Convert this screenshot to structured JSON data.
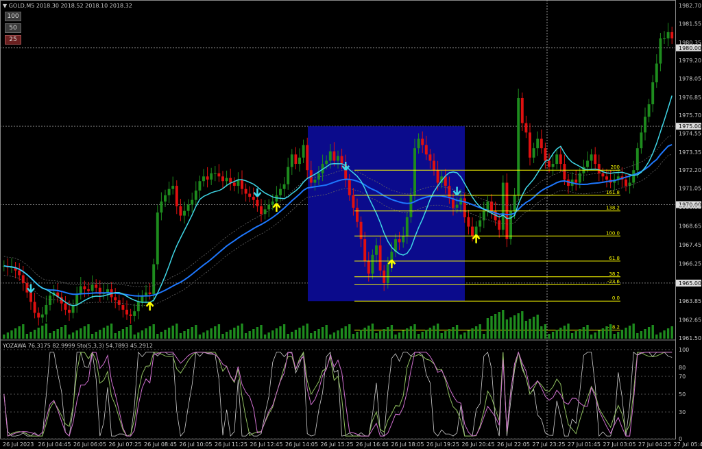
{
  "header": {
    "symbol": "GOLD,M5",
    "quote": "2018.30 2018.52 2018.10 2018.32"
  },
  "buttons": [
    {
      "label": "100",
      "color": "#3a3a3a"
    },
    {
      "label": "50",
      "color": "#3a3a3a"
    },
    {
      "label": "25",
      "color": "#6a2020"
    }
  ],
  "indicator": {
    "label": "YOZAWA 76.3175 82.9999",
    "sto_label": "Sto(5,3,3) 54.7893 45.2912"
  },
  "colors": {
    "bull": "#1e8c1e",
    "bear": "#e01010",
    "ma_fast": "#3fd6e6",
    "ma_slow": "#1e78ff",
    "fib": "#ffff00",
    "zone": "#0b0b8c",
    "osc_a": "#d070d0",
    "osc_b": "#90c060",
    "osc_c": "#cfcfcf"
  },
  "chart_data": {
    "type": "candlestick",
    "title": "GOLD,M5",
    "ylim": [
      1961.5,
      1982.7
    ],
    "price_axis_labels": [
      "1982.70",
      "1981.55",
      "1980.35",
      "1980.00",
      "1979.20",
      "1978.05",
      "1976.85",
      "1975.70",
      "1975.00",
      "1974.55",
      "1973.35",
      "1972.20",
      "1971.05",
      "1970.00",
      "1969.85",
      "1968.65",
      "1967.45",
      "1966.25",
      "1965.00",
      "1963.85",
      "1962.65",
      "1961.50"
    ],
    "highlighted_levels": [
      "1980.00",
      "1975.00",
      "1970.00",
      "1965.00"
    ],
    "time_labels": [
      "26 Jul 2023",
      "26 Jul 04:45",
      "26 Jul 06:05",
      "26 Jul 07:25",
      "26 Jul 08:45",
      "26 Jul 10:05",
      "26 Jul 11:25",
      "26 Jul 12:45",
      "26 Jul 14:05",
      "26 Jul 15:25",
      "26 Jul 16:45",
      "26 Jul 18:05",
      "26 Jul 19:25",
      "26 Jul 20:45",
      "26 Jul 22:05",
      "27 Jul 23:25",
      "27 Jul 01:45",
      "27 Jul 03:05",
      "27 Jul 04:25",
      "27 Jul 05:45"
    ],
    "fib_levels": [
      {
        "label": "200",
        "price": 1972.2
      },
      {
        "label": "161.8",
        "price": 1970.6
      },
      {
        "label": "138.2",
        "price": 1969.6
      },
      {
        "label": "100.0",
        "price": 1968.0
      },
      {
        "label": "61.8",
        "price": 1966.4
      },
      {
        "label": "38.2",
        "price": 1965.4
      },
      {
        "label": "-23.6",
        "price": 1964.9
      },
      {
        "label": "0.0",
        "price": 1963.85
      },
      {
        "label": "-38.2",
        "price": 1962.0
      }
    ],
    "zone": {
      "from_price": 1963.85,
      "to_price": 1975.0
    },
    "closes": [
      1966.1,
      1966.0,
      1966.0,
      1965.8,
      1965.5,
      1965.0,
      1964.4,
      1963.8,
      1963.1,
      1962.8,
      1963.0,
      1963.6,
      1964.2,
      1964.4,
      1964.1,
      1963.7,
      1963.3,
      1963.1,
      1963.6,
      1964.3,
      1964.8,
      1964.6,
      1964.5,
      1964.9,
      1964.7,
      1964.3,
      1964.4,
      1964.6,
      1964.1,
      1963.9,
      1963.6,
      1963.3,
      1963.0,
      1962.9,
      1963.2,
      1963.8,
      1964.2,
      1964.4,
      1964.3,
      1966.2,
      1969.5,
      1970.2,
      1970.6,
      1971.0,
      1971.2,
      1969.9,
      1969.3,
      1969.6,
      1970.0,
      1970.3,
      1970.9,
      1971.5,
      1971.8,
      1971.6,
      1972.0,
      1972.0,
      1971.8,
      1971.5,
      1971.7,
      1971.4,
      1971.2,
      1971.6,
      1971.0,
      1970.7,
      1970.5,
      1970.3,
      1969.9,
      1969.4,
      1969.7,
      1970.0,
      1970.2,
      1970.6,
      1971.0,
      1971.3,
      1972.4,
      1973.2,
      1972.6,
      1973.0,
      1973.8,
      1972.2,
      1971.4,
      1971.6,
      1972.0,
      1972.6,
      1972.8,
      1973.4,
      1972.8,
      1973.1,
      1972.6,
      1971.6,
      1970.6,
      1969.8,
      1968.9,
      1967.8,
      1966.4,
      1965.6,
      1966.8,
      1967.4,
      1965.8,
      1965.0,
      1966.2,
      1967.0,
      1967.8,
      1967.6,
      1968.0,
      1969.2,
      1970.6,
      1973.6,
      1974.2,
      1973.8,
      1973.2,
      1972.8,
      1972.2,
      1971.4,
      1971.8,
      1971.2,
      1970.4,
      1969.8,
      1970.0,
      1970.4,
      1969.2,
      1968.6,
      1968.0,
      1968.6,
      1969.0,
      1969.6,
      1970.2,
      1969.6,
      1969.0,
      1968.4,
      1971.4,
      1967.8,
      1969.6,
      1970.6,
      1976.8,
      1975.2,
      1974.6,
      1973.0,
      1973.6,
      1974.2,
      1973.6,
      1972.8,
      1972.4,
      1972.6,
      1973.2,
      1972.6,
      1971.6,
      1971.2,
      1971.6,
      1971.4,
      1972.0,
      1972.4,
      1972.8,
      1973.2,
      1972.6,
      1972.0,
      1971.8,
      1971.6,
      1971.4,
      1971.6,
      1971.8,
      1971.6,
      1971.2,
      1971.4,
      1972.2,
      1973.6,
      1974.6,
      1975.6,
      1976.4,
      1977.8,
      1979.0,
      1980.6,
      1980.6,
      1981.0,
      1980.6
    ]
  }
}
